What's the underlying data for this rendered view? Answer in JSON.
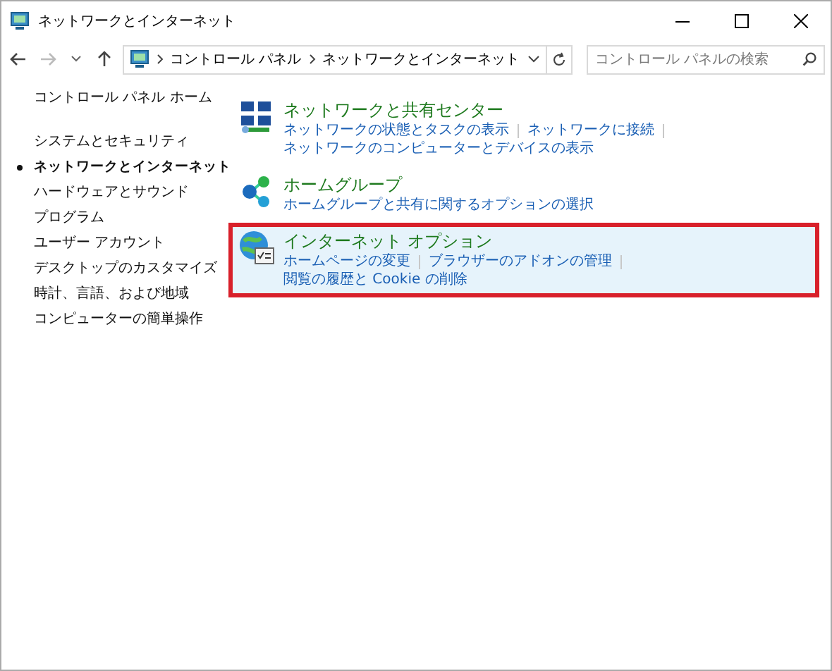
{
  "window": {
    "title": "ネットワークとインターネット"
  },
  "address": {
    "path": [
      "コントロール パネル",
      "ネットワークとインターネット"
    ]
  },
  "search": {
    "placeholder": "コントロール パネルの検索"
  },
  "sidebar": {
    "items": [
      {
        "label": "コントロール パネル ホーム",
        "selected": false
      },
      {
        "label": "システムとセキュリティ",
        "selected": false
      },
      {
        "label": "ネットワークとインターネット",
        "selected": true
      },
      {
        "label": "ハードウェアとサウンド",
        "selected": false
      },
      {
        "label": "プログラム",
        "selected": false
      },
      {
        "label": "ユーザー アカウント",
        "selected": false
      },
      {
        "label": "デスクトップのカスタマイズ",
        "selected": false
      },
      {
        "label": "時計、言語、および地域",
        "selected": false
      },
      {
        "label": "コンピューターの簡単操作",
        "selected": false
      }
    ]
  },
  "categories": [
    {
      "kind": "network",
      "title": "ネットワークと共有センター",
      "highlighted": false,
      "links": [
        "ネットワークの状態とタスクの表示",
        "ネットワークに接続",
        "ネットワークのコンピューターとデバイスの表示"
      ]
    },
    {
      "kind": "homegroup",
      "title": "ホームグループ",
      "highlighted": false,
      "links": [
        "ホームグループと共有に関するオプションの選択"
      ]
    },
    {
      "kind": "internet",
      "title": "インターネット オプション",
      "highlighted": true,
      "links": [
        "ホームページの変更",
        "ブラウザーのアドオンの管理",
        "閲覧の履歴と Cookie の削除"
      ]
    }
  ]
}
